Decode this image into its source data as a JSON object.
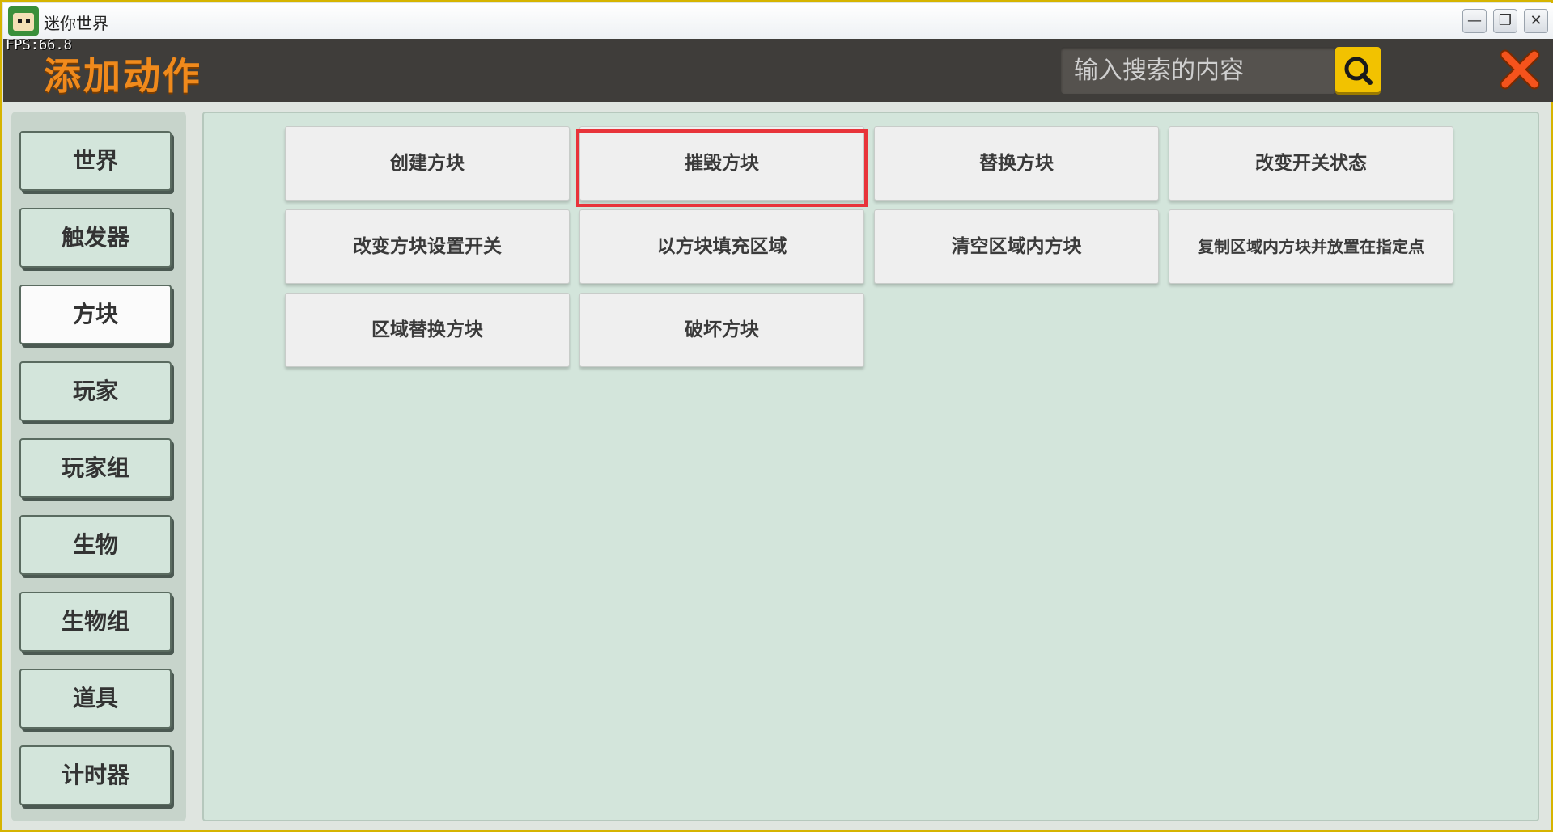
{
  "window": {
    "title": "迷你世界",
    "fps_label": "FPS:66.8",
    "controls": {
      "minimize": "—",
      "restore": "❐",
      "close": "✕"
    }
  },
  "header": {
    "title": "添加动作",
    "search": {
      "placeholder": "输入搜索的内容",
      "value": ""
    },
    "search_icon": "search-icon",
    "close_icon": "close-icon"
  },
  "sidebar": {
    "items": [
      {
        "label": "世界",
        "active": false
      },
      {
        "label": "触发器",
        "active": false
      },
      {
        "label": "方块",
        "active": true
      },
      {
        "label": "玩家",
        "active": false
      },
      {
        "label": "玩家组",
        "active": false
      },
      {
        "label": "生物",
        "active": false
      },
      {
        "label": "生物组",
        "active": false
      },
      {
        "label": "道具",
        "active": false
      },
      {
        "label": "计时器",
        "active": false
      }
    ]
  },
  "actions": {
    "items": [
      {
        "label": "创建方块"
      },
      {
        "label": "摧毁方块",
        "highlighted": true
      },
      {
        "label": "替换方块"
      },
      {
        "label": "改变开关状态"
      },
      {
        "label": "改变方块设置开关"
      },
      {
        "label": "以方块填充区域"
      },
      {
        "label": "清空区域内方块"
      },
      {
        "label": "复制区域内方块并放置在指定点"
      },
      {
        "label": "区域替换方块"
      },
      {
        "label": "破坏方块"
      }
    ]
  },
  "colors": {
    "title_orange": "#f08a1c",
    "header_bg": "#3f3d3a",
    "panel_bg": "#d3e5db",
    "search_button": "#f2c200",
    "highlight": "#e8343a"
  }
}
